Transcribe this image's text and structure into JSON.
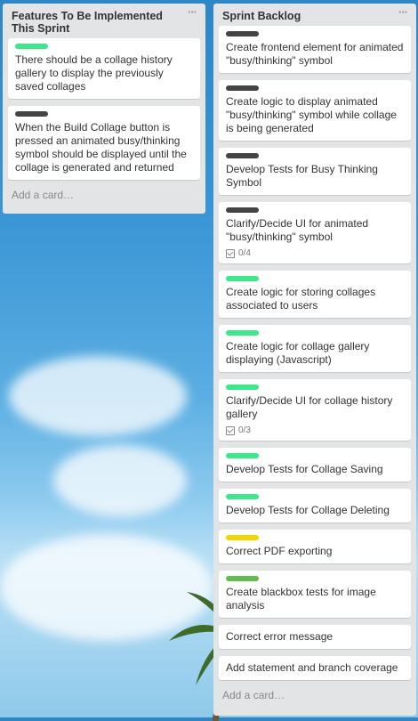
{
  "colors": {
    "green": "#61bd4f",
    "mint": "#3ee88a",
    "dark": "#444444",
    "yellow": "#f2d600"
  },
  "list1": {
    "title": "Features To Be Implemented This Sprint",
    "menu": "···",
    "add_card": "Add a card…",
    "cards": [
      {
        "label": "mint",
        "text": "There should be a collage history gallery to display the previously saved collages"
      },
      {
        "label": "dark",
        "text": "When the Build Collage button is pressed an animated busy/thinking symbol should be displayed until the collage is generated and returned"
      }
    ]
  },
  "list2": {
    "title": "Sprint Backlog",
    "menu": "···",
    "add_card": "Add a card…",
    "cards": [
      {
        "label": "dark",
        "text": "Create frontend element for animated \"busy/thinking\" symbol"
      },
      {
        "label": "dark",
        "text": "Create logic to display animated \"busy/thinking\" symbol while collage is being generated"
      },
      {
        "label": "dark",
        "text": "Develop Tests for Busy Thinking Symbol"
      },
      {
        "label": "dark",
        "text": "Clarify/Decide UI for animated \"busy/thinking\" symbol",
        "checklist": "0/4"
      },
      {
        "label": "mint",
        "text": "Create logic for storing collages associated to users"
      },
      {
        "label": "mint",
        "text": "Create logic for collage gallery displaying (Javascript)"
      },
      {
        "label": "mint",
        "text": "Clarify/Decide UI for collage history gallery",
        "checklist": "0/3"
      },
      {
        "label": "mint",
        "text": "Develop Tests for Collage Saving"
      },
      {
        "label": "mint",
        "text": "Develop Tests for Collage Deleting"
      },
      {
        "label": "yellow",
        "text": "Correct PDF exporting"
      },
      {
        "label": "green",
        "text": "Create blackbox tests for image analysis"
      },
      {
        "label": null,
        "text": "Correct error message"
      },
      {
        "label": null,
        "text": "Add statement and branch coverage"
      }
    ]
  }
}
